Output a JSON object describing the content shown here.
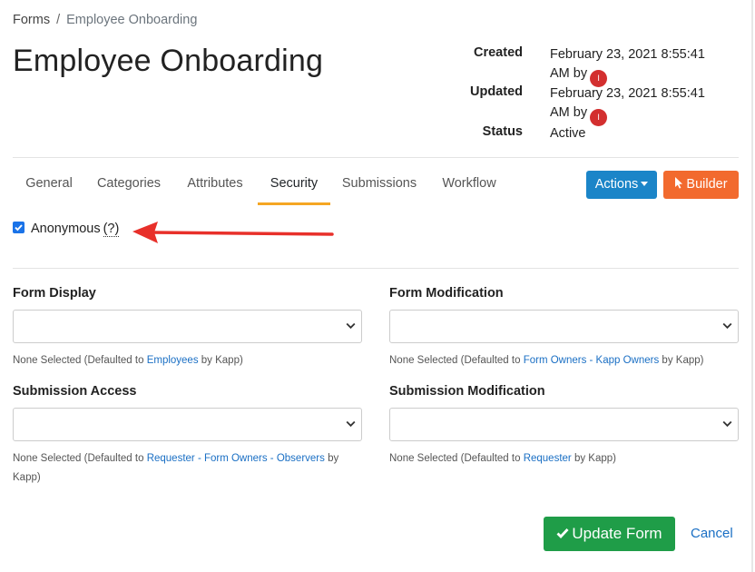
{
  "breadcrumb": {
    "root": "Forms",
    "separator": "/",
    "current": "Employee Onboarding"
  },
  "title": "Employee Onboarding",
  "meta": {
    "created_label": "Created",
    "created_value": "February 23, 2021 8:55:41 AM by",
    "updated_label": "Updated",
    "updated_value": "February 23, 2021 8:55:41 AM by",
    "status_label": "Status",
    "status_value": "Active",
    "avatar_initial": "I"
  },
  "tabs": [
    {
      "label": "General"
    },
    {
      "label": "Categories"
    },
    {
      "label": "Attributes"
    },
    {
      "label": "Security",
      "active": true
    },
    {
      "label": "Submissions"
    },
    {
      "label": "Workflow"
    }
  ],
  "buttons": {
    "actions": "Actions",
    "builder": "Builder",
    "update": "Update Form",
    "cancel": "Cancel"
  },
  "anonymous": {
    "label": "Anonymous",
    "help": "(?)",
    "checked": true
  },
  "fields": {
    "form_display": {
      "label": "Form Display",
      "value": "",
      "help_prefix": "None Selected (Defaulted to ",
      "help_link": "Employees",
      "help_suffix": " by Kapp)"
    },
    "form_modification": {
      "label": "Form Modification",
      "value": "",
      "help_prefix": "None Selected (Defaulted to ",
      "help_link": "Form Owners - Kapp Owners",
      "help_suffix": " by Kapp)"
    },
    "submission_access": {
      "label": "Submission Access",
      "value": "",
      "help_prefix": "None Selected (Defaulted to ",
      "help_link": "Requester - Form Owners - Observers",
      "help_suffix": " by Kapp)"
    },
    "submission_modification": {
      "label": "Submission Modification",
      "value": "",
      "help_prefix": "None Selected (Defaulted to ",
      "help_link": "Requester",
      "help_suffix": " by Kapp)"
    }
  },
  "colors": {
    "actions": "#1b85c8",
    "builder": "#f26a2e",
    "update": "#1f9d48",
    "tab_active": "#f5a623",
    "arrow": "#e8302a"
  }
}
